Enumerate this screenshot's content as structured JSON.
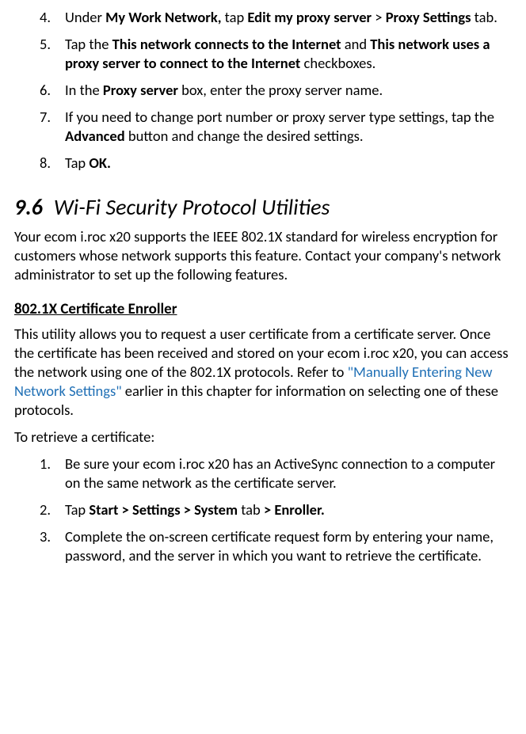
{
  "list1": {
    "i4": {
      "num": "4.",
      "t1": "Under ",
      "b1": "My Work Network,",
      "t2": " tap ",
      "b2": "Edit my proxy server",
      "t3": " > ",
      "b3": "Proxy ",
      "b3b": "Settings",
      "t4": " tab."
    },
    "i5": {
      "num": "5.",
      "t1": "Tap the ",
      "b1": "This network connects to the Internet",
      "t2": " and ",
      "b2": "This network uses a proxy server to connect to the Internet",
      "t3": " checkboxes."
    },
    "i6": {
      "num": "6.",
      "t1": "In the ",
      "b1": "Proxy server",
      "t2": " box, enter the proxy server name."
    },
    "i7": {
      "num": "7.",
      "t1": "If you need to change port number or proxy server type settings, tap the ",
      "b1": "Advanced",
      "t2": " button and change the desired settings."
    },
    "i8": {
      "num": "8.",
      "t1": "Tap ",
      "b1": "OK."
    }
  },
  "section": {
    "num": "9.6",
    "title": "Wi-Fi Security Protocol Utilities"
  },
  "para1": "Your ecom i.roc x20 supports the IEEE 802.1X standard for wireless encryption for customers whose network supports this feature. Contact your company's network administrator to set up the following features.",
  "subheading": "802.1X Certificate Enroller",
  "para2": {
    "t1": "This utility allows you to request a user certificate from a certificate server. Once the certificate has been received and stored on your ecom i.roc x20, you can access the network using one of the 802.1X protocols. Refer to ",
    "link": "\"Manually Entering New Network Settings\"",
    "t2": " earlier in this chapter for information on selecting one of these protocols."
  },
  "para3": "To retrieve a certificate:",
  "list2": {
    "i1": {
      "num": "1.",
      "t1": "Be sure your ecom i.roc x20 has an ActiveSync connection to a computer on the same network as the certificate server."
    },
    "i2": {
      "num": "2.",
      "t1": "Tap ",
      "b1": "Start > Settings > System",
      "t2": " tab ",
      "b2": "> Enroller."
    },
    "i3": {
      "num": "3.",
      "t1": "Complete the on-screen certificate request form by entering your name, password, and the server in which you want to retrieve the certificate."
    }
  }
}
